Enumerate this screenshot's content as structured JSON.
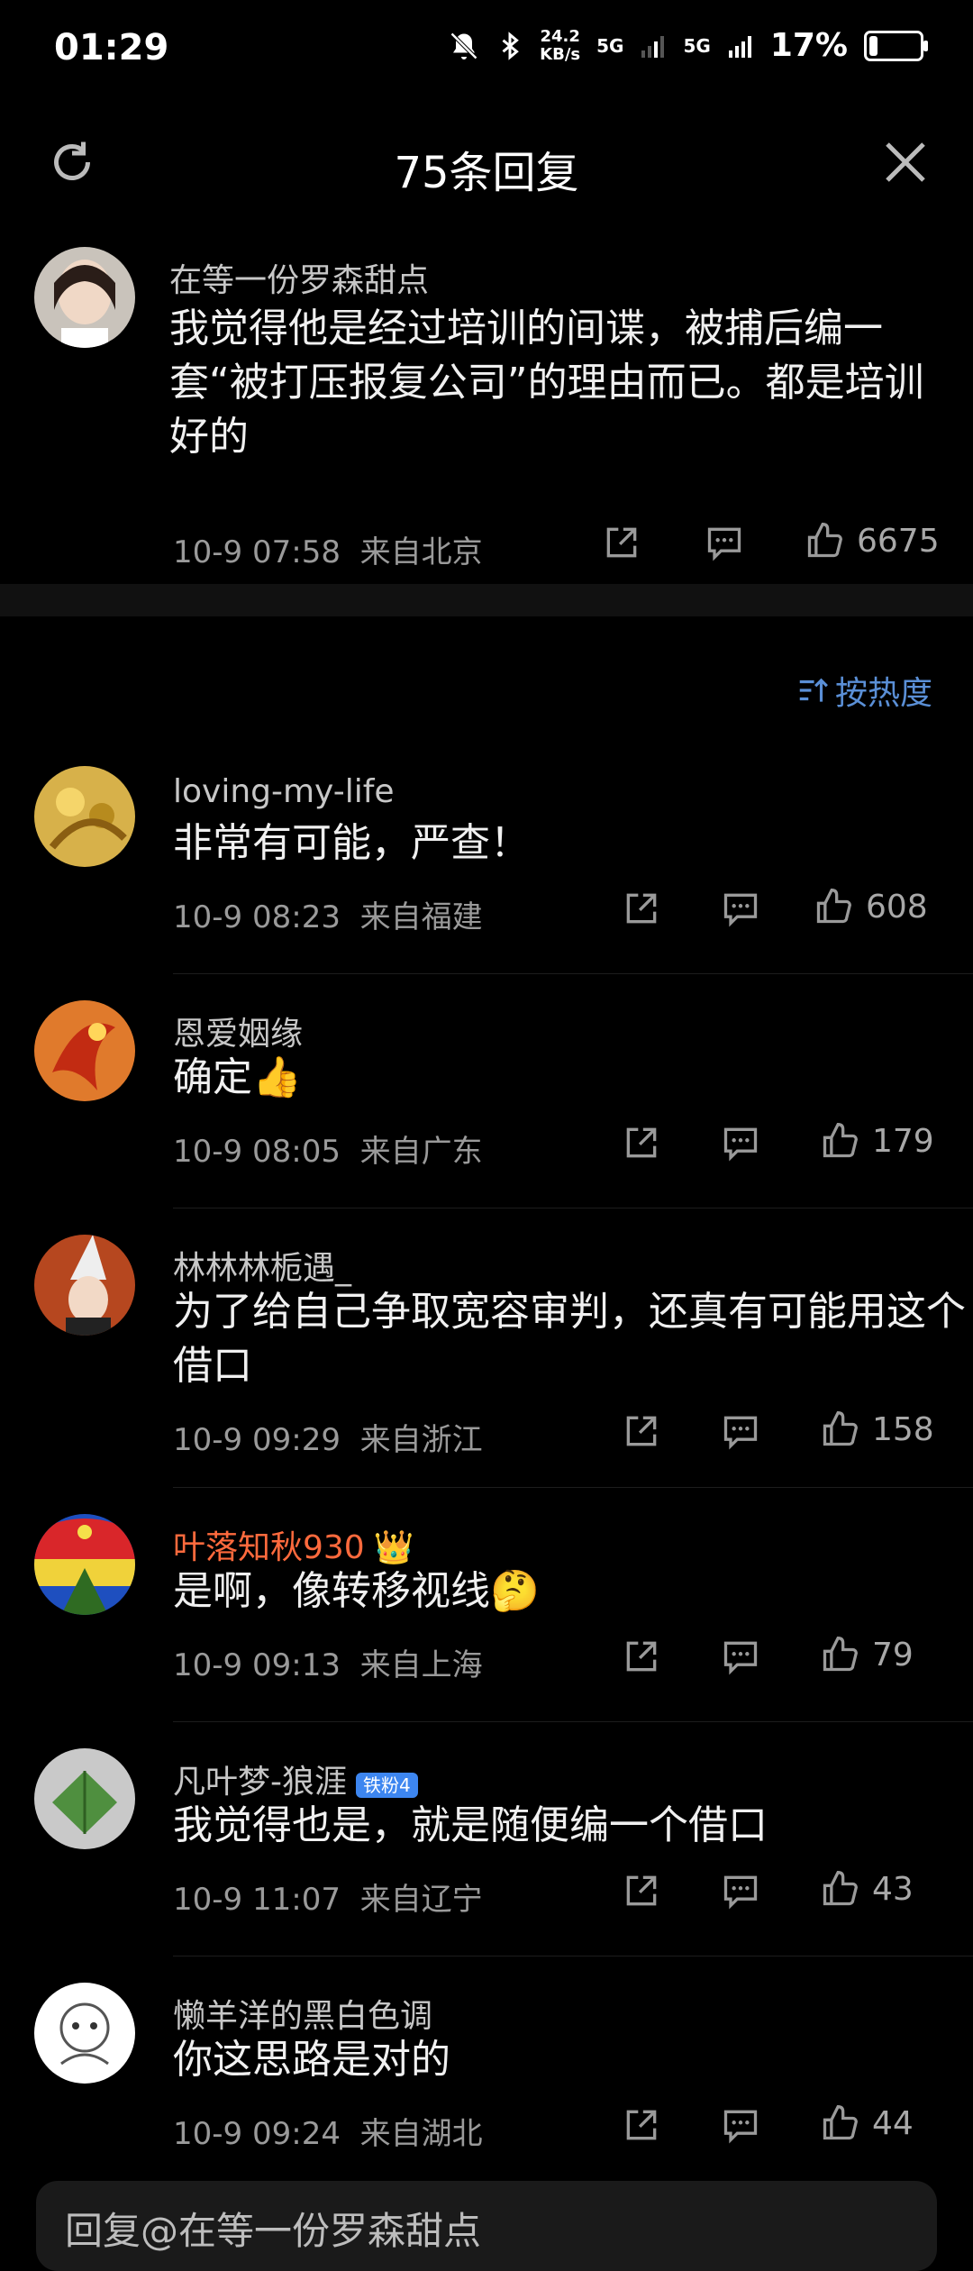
{
  "status_bar": {
    "time": "01:29",
    "speed_value": "24.2",
    "speed_unit": "KB/s",
    "net1": "5G",
    "net2": "5G",
    "battery": "17%",
    "battery_level": 0.17
  },
  "header": {
    "title": "75条回复"
  },
  "main_comment": {
    "username": "在等一份罗森甜点",
    "text": "我觉得他是经过培训的间谍，被捕后编一套“被打压报复公司”的理由而已。都是培训好的",
    "time": "10-9 07:58",
    "location": "来自北京",
    "likes": "6675"
  },
  "sort": {
    "label": "按热度"
  },
  "replies": [
    {
      "username": "loving-my-life",
      "text": "非常有可能，严查！",
      "time": "10-9 08:23",
      "location": "来自福建",
      "likes": "608"
    },
    {
      "username": "恩爱姻缘",
      "text": "确定👍",
      "time": "10-9 08:05",
      "location": "来自广东",
      "likes": "179"
    },
    {
      "username": "林林林栀遇_",
      "text": "为了给自己争取宽容审判，还真有可能用这个借口",
      "time": "10-9 09:29",
      "location": "来自浙江",
      "likes": "158"
    },
    {
      "username": "叶落知秋930",
      "text": "是啊，像转移视线🤔",
      "time": "10-9 09:13",
      "location": "来自上海",
      "likes": "79"
    },
    {
      "username": "凡叶梦-狼涯",
      "badge": "铁粉4",
      "text": "我觉得也是，就是随便编一个借口",
      "time": "10-9 11:07",
      "location": "来自辽宁",
      "likes": "43"
    },
    {
      "username": "懒羊洋的黑白色调",
      "text": "你这思路是对的",
      "time": "10-9 09:24",
      "location": "来自湖北",
      "likes": "44"
    }
  ],
  "reply_input": {
    "text": "回复@在等一份罗森甜点"
  },
  "colors": {
    "accent": "#5a8fd6",
    "vip_name": "#ff6a3d",
    "background": "#000000"
  }
}
